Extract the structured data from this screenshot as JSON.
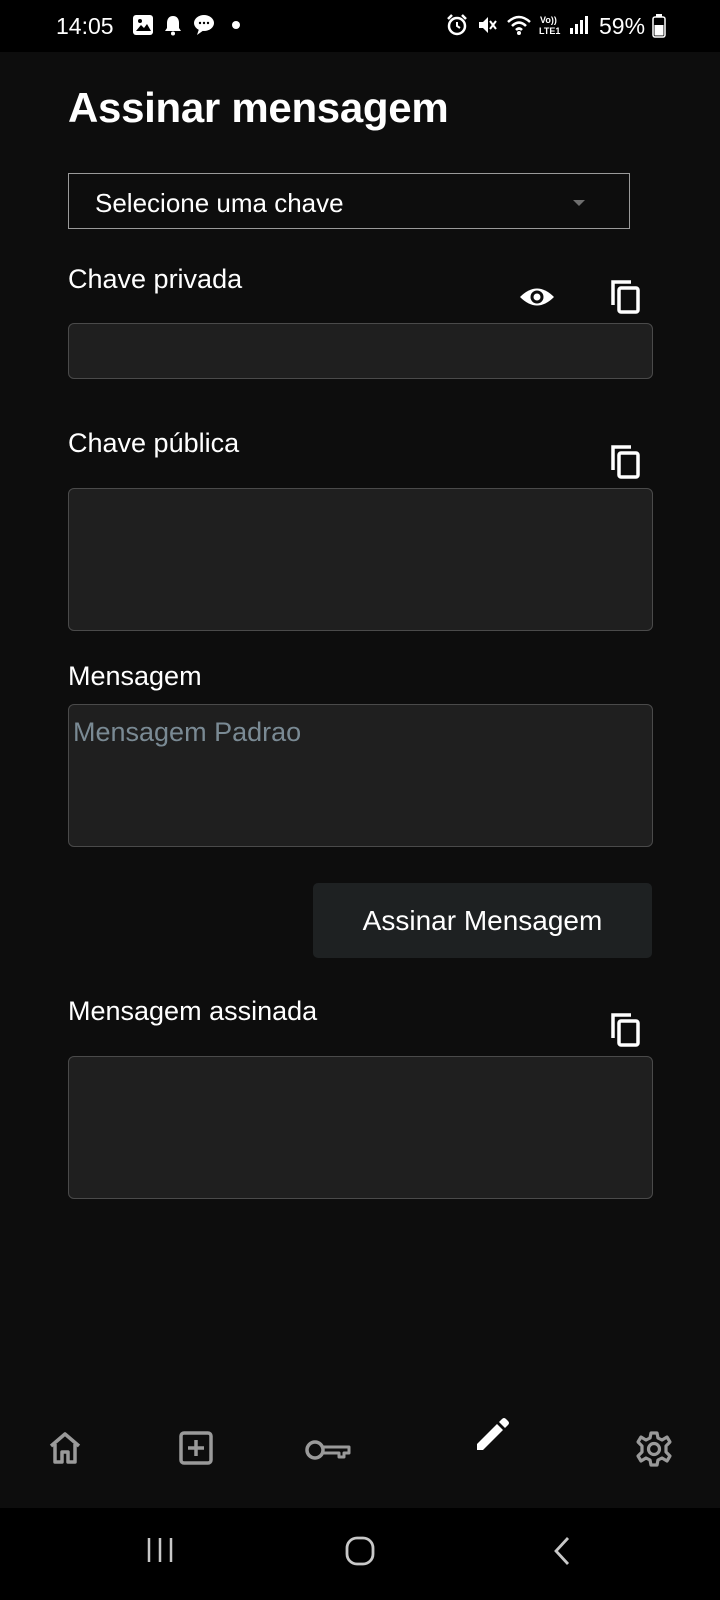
{
  "status_bar": {
    "time": "14:05",
    "battery": "59%",
    "left_icons": [
      "gallery-icon",
      "notification-bell-icon",
      "chat-icon",
      "dot-icon"
    ],
    "right_icons": [
      "alarm-icon",
      "mute-icon",
      "wifi-icon",
      "volte-icon",
      "signal-icon",
      "battery-icon"
    ]
  },
  "page": {
    "title": "Assinar mensagem"
  },
  "key_select": {
    "label": "Selecione uma chave"
  },
  "fields": {
    "private_key": {
      "label": "Chave privada",
      "value": ""
    },
    "public_key": {
      "label": "Chave pública",
      "value": ""
    },
    "message": {
      "label": "Mensagem",
      "placeholder": "Mensagem Padrao",
      "value": ""
    },
    "signed_message": {
      "label": "Mensagem assinada",
      "value": ""
    }
  },
  "sign_button": {
    "label": "Assinar Mensagem"
  },
  "bottom_nav": {
    "items": [
      "home-icon",
      "add-box-icon",
      "key-icon",
      "pencil-icon",
      "settings-icon"
    ],
    "active": "pencil-icon"
  },
  "system_nav": [
    "recents-icon",
    "home-button-icon",
    "back-icon"
  ],
  "colors": {
    "background": "#0d0d0d",
    "field_background": "#1f1f1f",
    "field_border": "#4a4a4a",
    "button_background": "#1e2122",
    "placeholder": "#7a8a94"
  }
}
